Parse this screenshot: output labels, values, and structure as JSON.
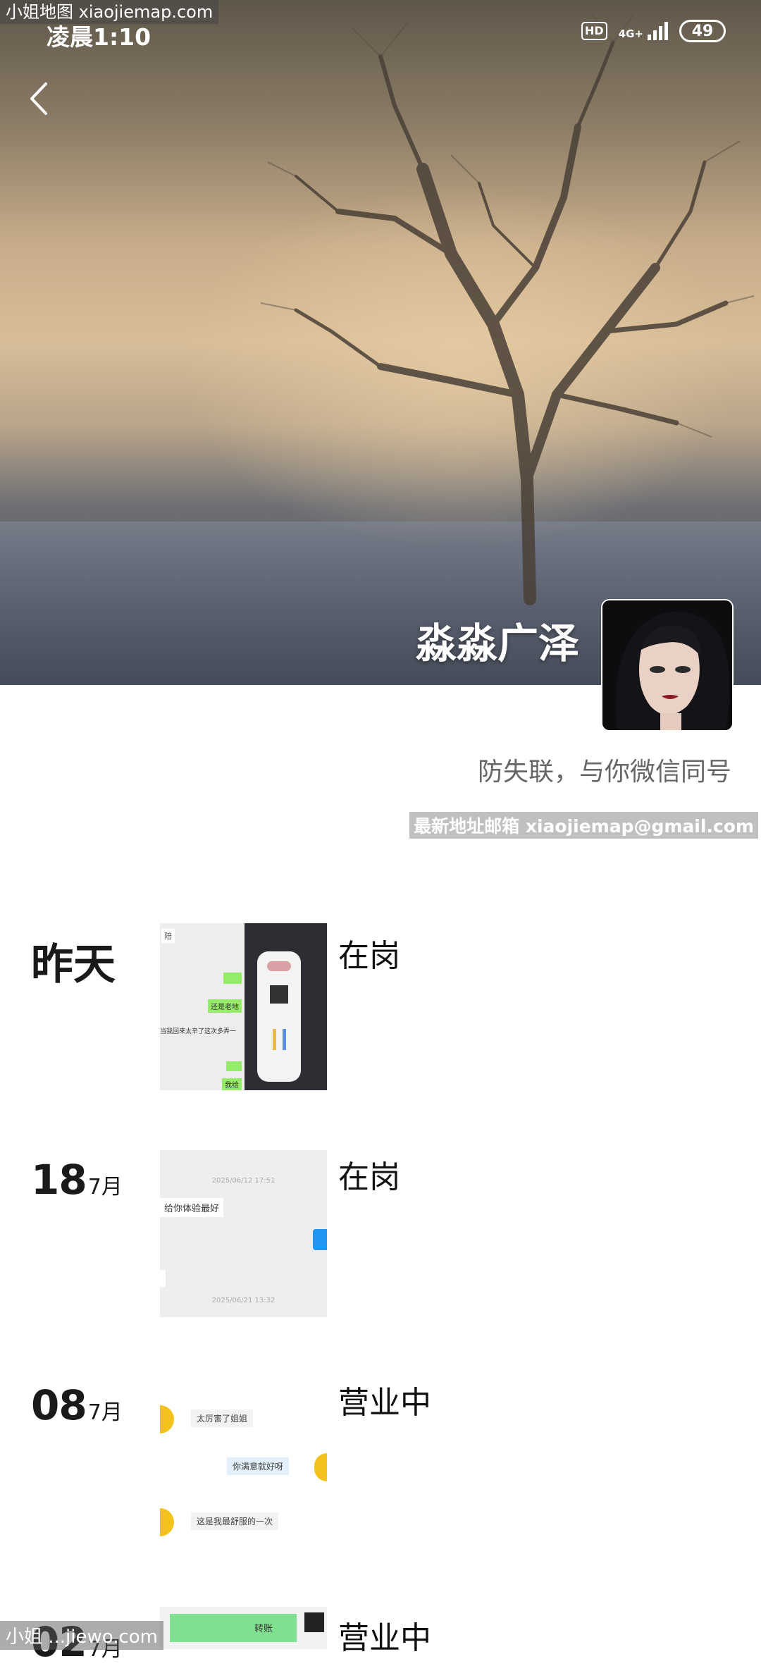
{
  "watermark": {
    "top": "小姐地图 xiaojiemap.com",
    "email": "最新地址邮箱 xiaojiemap@gmail.com",
    "bottom": "小姐 ...jiewo.com"
  },
  "status_bar": {
    "time": "凌晨1:10",
    "hd": "HD",
    "network": "4G+",
    "battery": "49"
  },
  "profile": {
    "name": "淼淼广泽",
    "signature": "防失联，与你微信同号"
  },
  "timeline": [
    {
      "date_label": "昨天",
      "text": "在岗"
    },
    {
      "day": "18",
      "month": "7月",
      "text": "在岗"
    },
    {
      "day": "08",
      "month": "7月",
      "text": "营业中"
    },
    {
      "day": "02",
      "month": "7月",
      "text": "营业中"
    }
  ],
  "thumbnails": {
    "t1_left": [
      "陪",
      "还是老地",
      "当我回来太辛了这次多弄一",
      "我给"
    ],
    "t2": {
      "time1": "2025/06/12 17:51",
      "msg": "给你体验最好",
      "time2": "2025/06/21 13:32"
    },
    "t3": {
      "m1": "太厉害了姐姐",
      "m2": "你满意就好呀",
      "m3": "这是我最舒服的一次"
    },
    "t4": {
      "m1": "转账"
    }
  },
  "colors": {
    "accent_green": "#95ec69",
    "text_dark": "#111111",
    "text_muted": "#666666"
  }
}
